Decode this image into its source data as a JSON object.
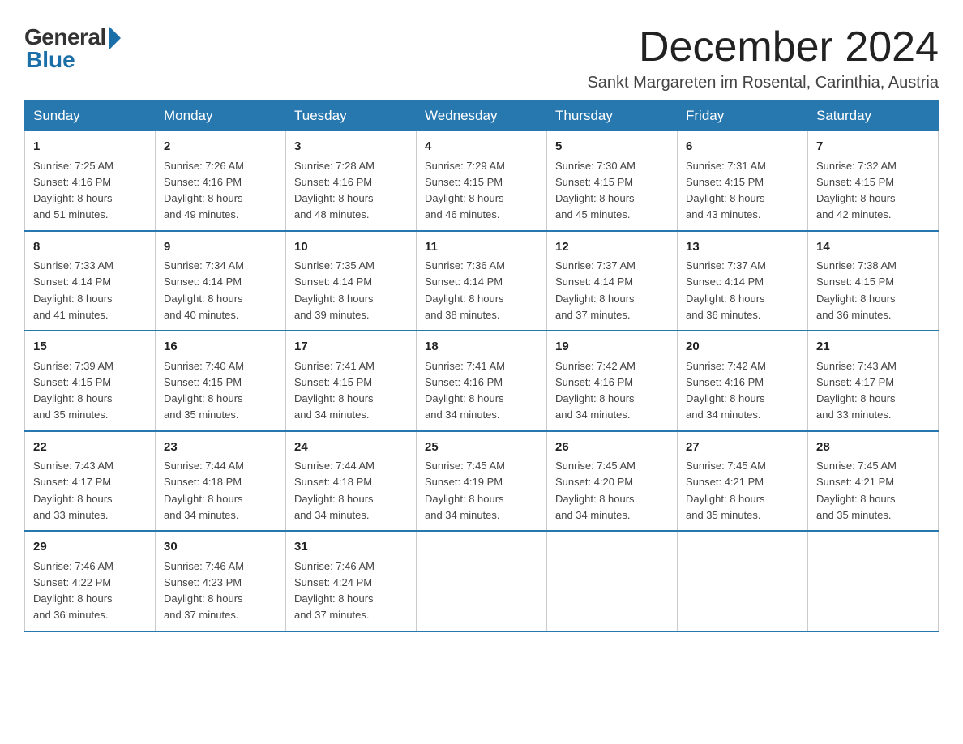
{
  "header": {
    "logo_general": "General",
    "logo_blue": "Blue",
    "month_title": "December 2024",
    "location": "Sankt Margareten im Rosental, Carinthia, Austria"
  },
  "weekdays": [
    "Sunday",
    "Monday",
    "Tuesday",
    "Wednesday",
    "Thursday",
    "Friday",
    "Saturday"
  ],
  "weeks": [
    [
      {
        "day": 1,
        "sunrise": "7:25 AM",
        "sunset": "4:16 PM",
        "daylight": "8 hours and 51 minutes."
      },
      {
        "day": 2,
        "sunrise": "7:26 AM",
        "sunset": "4:16 PM",
        "daylight": "8 hours and 49 minutes."
      },
      {
        "day": 3,
        "sunrise": "7:28 AM",
        "sunset": "4:16 PM",
        "daylight": "8 hours and 48 minutes."
      },
      {
        "day": 4,
        "sunrise": "7:29 AM",
        "sunset": "4:15 PM",
        "daylight": "8 hours and 46 minutes."
      },
      {
        "day": 5,
        "sunrise": "7:30 AM",
        "sunset": "4:15 PM",
        "daylight": "8 hours and 45 minutes."
      },
      {
        "day": 6,
        "sunrise": "7:31 AM",
        "sunset": "4:15 PM",
        "daylight": "8 hours and 43 minutes."
      },
      {
        "day": 7,
        "sunrise": "7:32 AM",
        "sunset": "4:15 PM",
        "daylight": "8 hours and 42 minutes."
      }
    ],
    [
      {
        "day": 8,
        "sunrise": "7:33 AM",
        "sunset": "4:14 PM",
        "daylight": "8 hours and 41 minutes."
      },
      {
        "day": 9,
        "sunrise": "7:34 AM",
        "sunset": "4:14 PM",
        "daylight": "8 hours and 40 minutes."
      },
      {
        "day": 10,
        "sunrise": "7:35 AM",
        "sunset": "4:14 PM",
        "daylight": "8 hours and 39 minutes."
      },
      {
        "day": 11,
        "sunrise": "7:36 AM",
        "sunset": "4:14 PM",
        "daylight": "8 hours and 38 minutes."
      },
      {
        "day": 12,
        "sunrise": "7:37 AM",
        "sunset": "4:14 PM",
        "daylight": "8 hours and 37 minutes."
      },
      {
        "day": 13,
        "sunrise": "7:37 AM",
        "sunset": "4:14 PM",
        "daylight": "8 hours and 36 minutes."
      },
      {
        "day": 14,
        "sunrise": "7:38 AM",
        "sunset": "4:15 PM",
        "daylight": "8 hours and 36 minutes."
      }
    ],
    [
      {
        "day": 15,
        "sunrise": "7:39 AM",
        "sunset": "4:15 PM",
        "daylight": "8 hours and 35 minutes."
      },
      {
        "day": 16,
        "sunrise": "7:40 AM",
        "sunset": "4:15 PM",
        "daylight": "8 hours and 35 minutes."
      },
      {
        "day": 17,
        "sunrise": "7:41 AM",
        "sunset": "4:15 PM",
        "daylight": "8 hours and 34 minutes."
      },
      {
        "day": 18,
        "sunrise": "7:41 AM",
        "sunset": "4:16 PM",
        "daylight": "8 hours and 34 minutes."
      },
      {
        "day": 19,
        "sunrise": "7:42 AM",
        "sunset": "4:16 PM",
        "daylight": "8 hours and 34 minutes."
      },
      {
        "day": 20,
        "sunrise": "7:42 AM",
        "sunset": "4:16 PM",
        "daylight": "8 hours and 34 minutes."
      },
      {
        "day": 21,
        "sunrise": "7:43 AM",
        "sunset": "4:17 PM",
        "daylight": "8 hours and 33 minutes."
      }
    ],
    [
      {
        "day": 22,
        "sunrise": "7:43 AM",
        "sunset": "4:17 PM",
        "daylight": "8 hours and 33 minutes."
      },
      {
        "day": 23,
        "sunrise": "7:44 AM",
        "sunset": "4:18 PM",
        "daylight": "8 hours and 34 minutes."
      },
      {
        "day": 24,
        "sunrise": "7:44 AM",
        "sunset": "4:18 PM",
        "daylight": "8 hours and 34 minutes."
      },
      {
        "day": 25,
        "sunrise": "7:45 AM",
        "sunset": "4:19 PM",
        "daylight": "8 hours and 34 minutes."
      },
      {
        "day": 26,
        "sunrise": "7:45 AM",
        "sunset": "4:20 PM",
        "daylight": "8 hours and 34 minutes."
      },
      {
        "day": 27,
        "sunrise": "7:45 AM",
        "sunset": "4:21 PM",
        "daylight": "8 hours and 35 minutes."
      },
      {
        "day": 28,
        "sunrise": "7:45 AM",
        "sunset": "4:21 PM",
        "daylight": "8 hours and 35 minutes."
      }
    ],
    [
      {
        "day": 29,
        "sunrise": "7:46 AM",
        "sunset": "4:22 PM",
        "daylight": "8 hours and 36 minutes."
      },
      {
        "day": 30,
        "sunrise": "7:46 AM",
        "sunset": "4:23 PM",
        "daylight": "8 hours and 37 minutes."
      },
      {
        "day": 31,
        "sunrise": "7:46 AM",
        "sunset": "4:24 PM",
        "daylight": "8 hours and 37 minutes."
      },
      null,
      null,
      null,
      null
    ]
  ],
  "labels": {
    "sunrise": "Sunrise: ",
    "sunset": "Sunset: ",
    "daylight": "Daylight: "
  }
}
